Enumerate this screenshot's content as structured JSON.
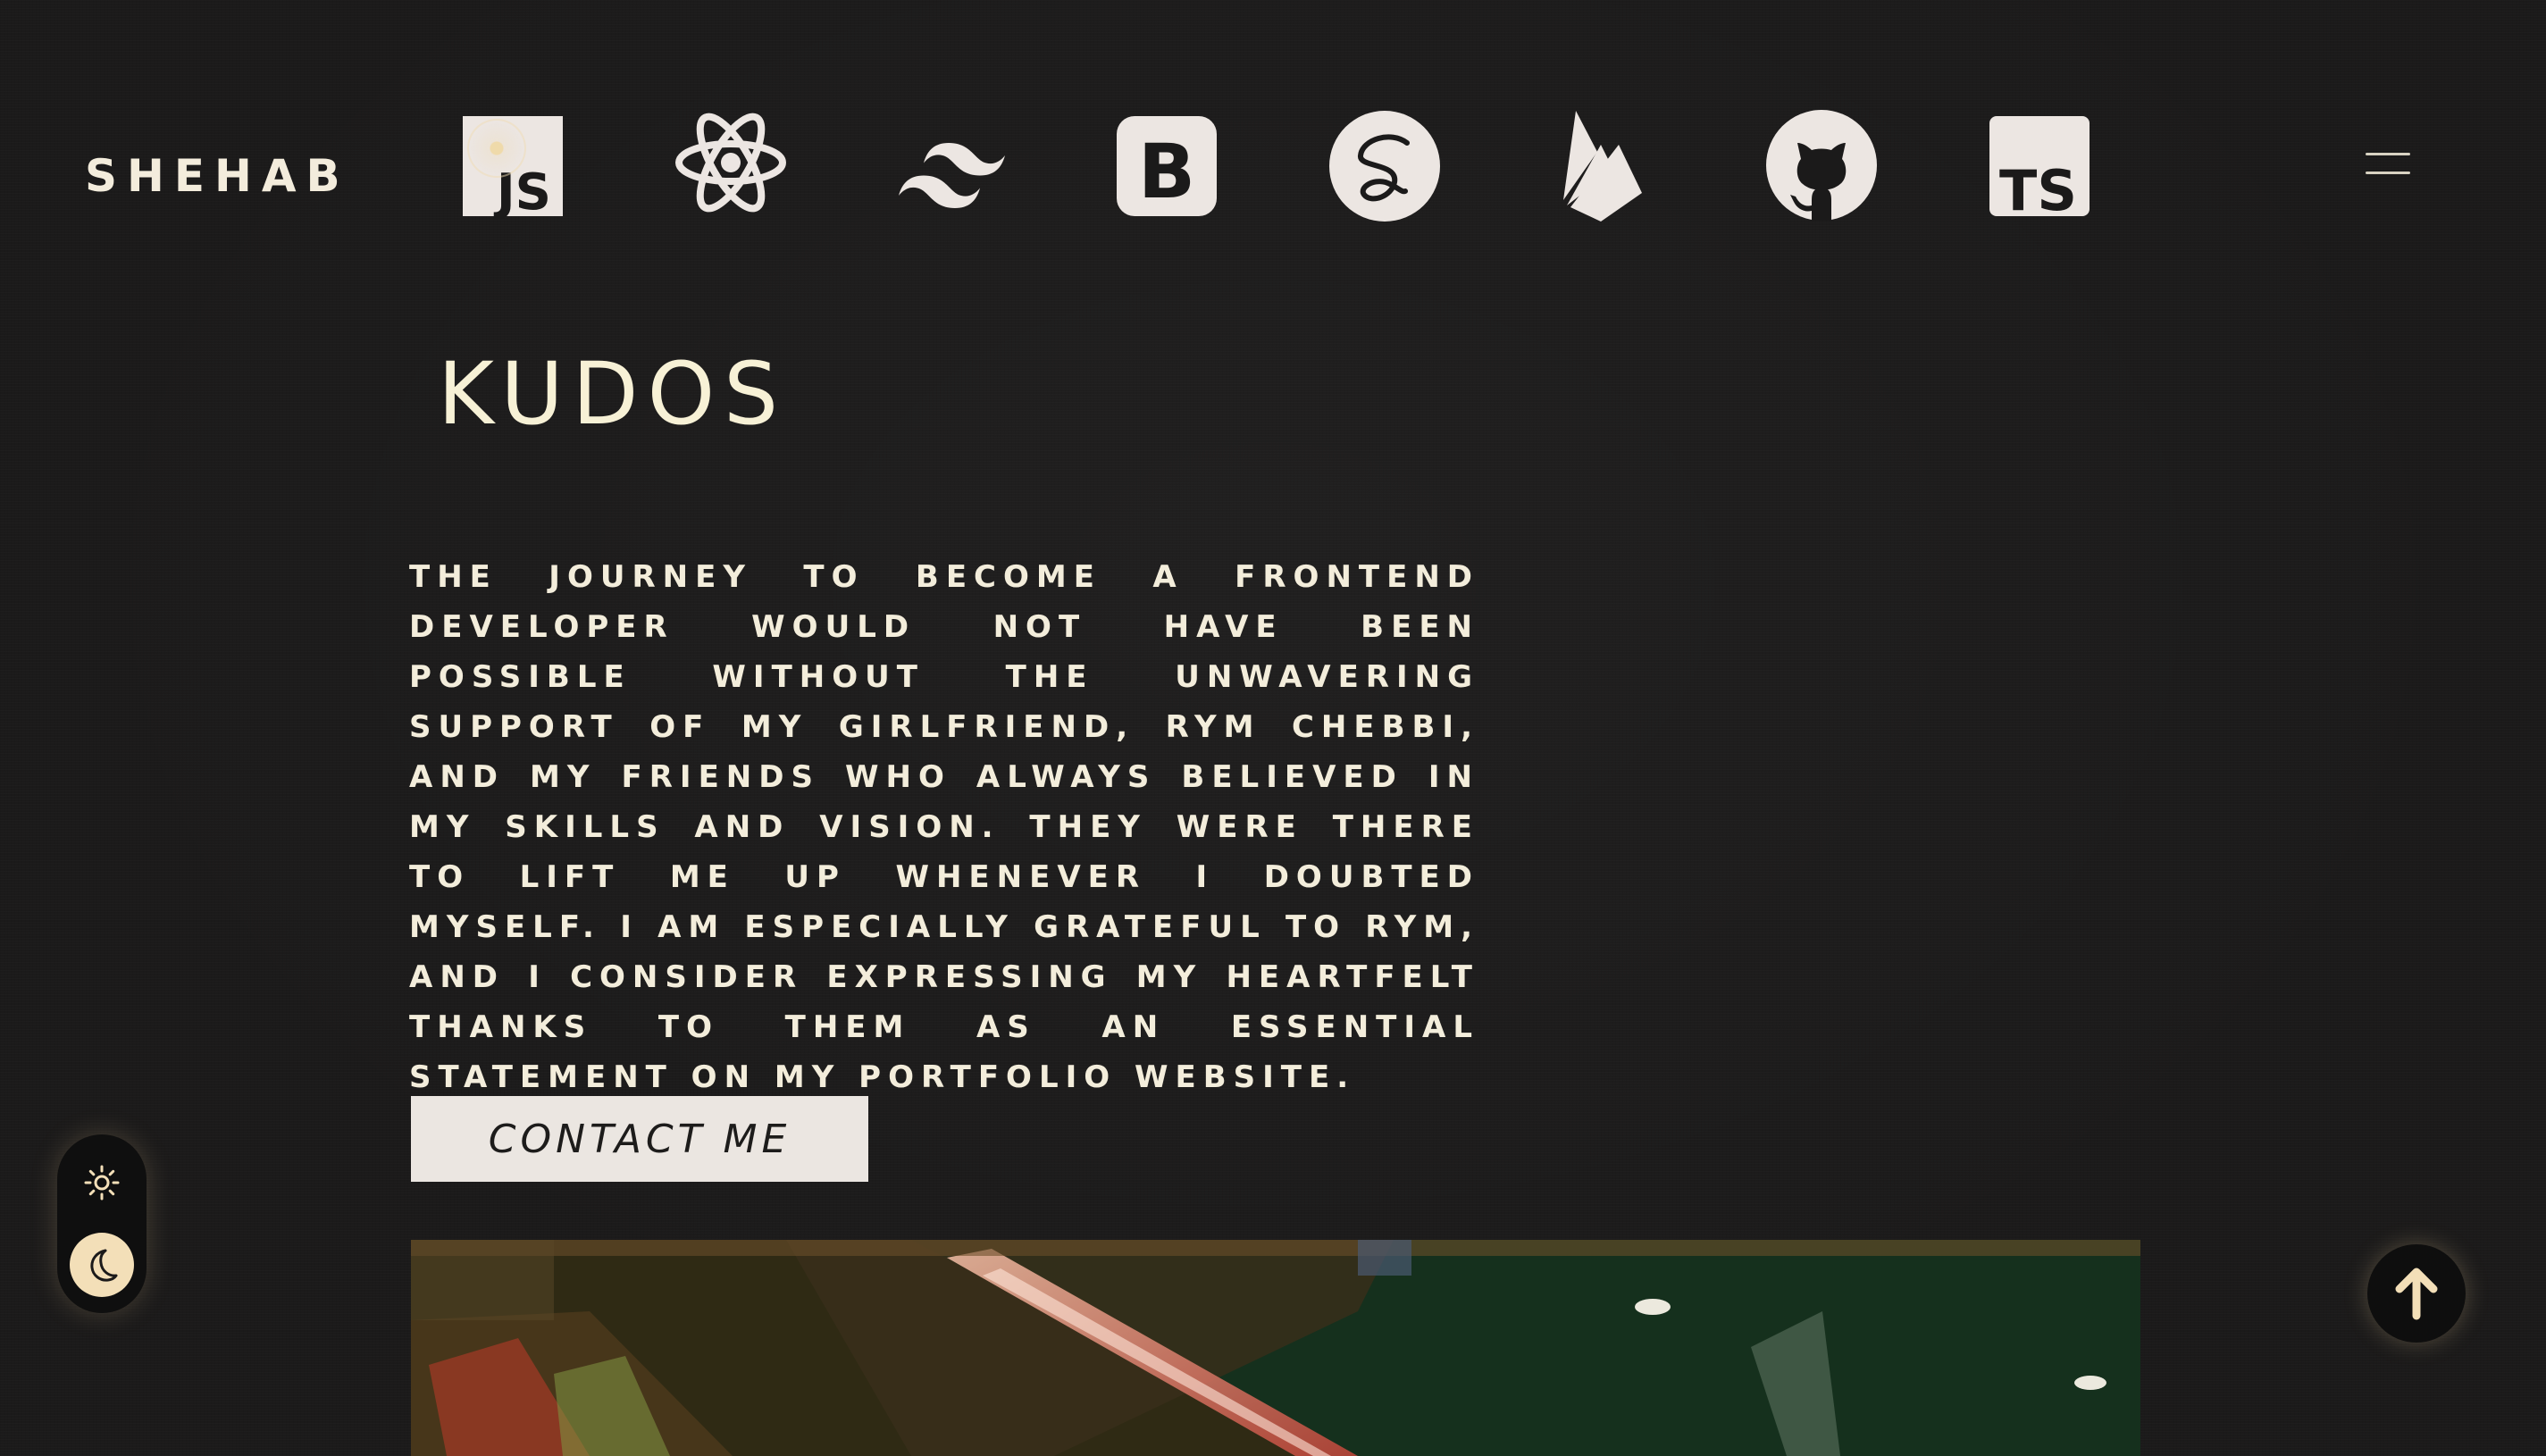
{
  "header": {
    "logo": "SHEHAB",
    "menu_icon": "hamburger-icon"
  },
  "tech_icons": [
    {
      "name": "javascript-icon",
      "label": "JS"
    },
    {
      "name": "react-icon"
    },
    {
      "name": "tailwind-icon"
    },
    {
      "name": "bootstrap-icon",
      "label": "B"
    },
    {
      "name": "sass-icon"
    },
    {
      "name": "firebase-icon"
    },
    {
      "name": "github-icon"
    },
    {
      "name": "typescript-icon",
      "label": "TS"
    }
  ],
  "main": {
    "title": "KUDOS",
    "paragraph": "The journey to become a frontend developer would not have been possible without the unwavering support of my girlfriend, Rym Chebbi, and my friends who always believed in my skills and vision. They were there to lift me up whenever I doubted myself. I am especially grateful to Rym, and I consider expressing my heartfelt thanks to them as an essential statement on my portfolio website.",
    "contact_button": "CONTACT ME"
  },
  "theme_toggle": {
    "light_icon": "sun-icon",
    "dark_icon": "moon-icon",
    "active": "dark"
  },
  "scroll_top": {
    "icon": "arrow-up-icon"
  },
  "colors": {
    "background": "#1b1a1a",
    "text": "#f5eed9",
    "icon": "#ece6e2",
    "accent": "#f3dfb8"
  }
}
